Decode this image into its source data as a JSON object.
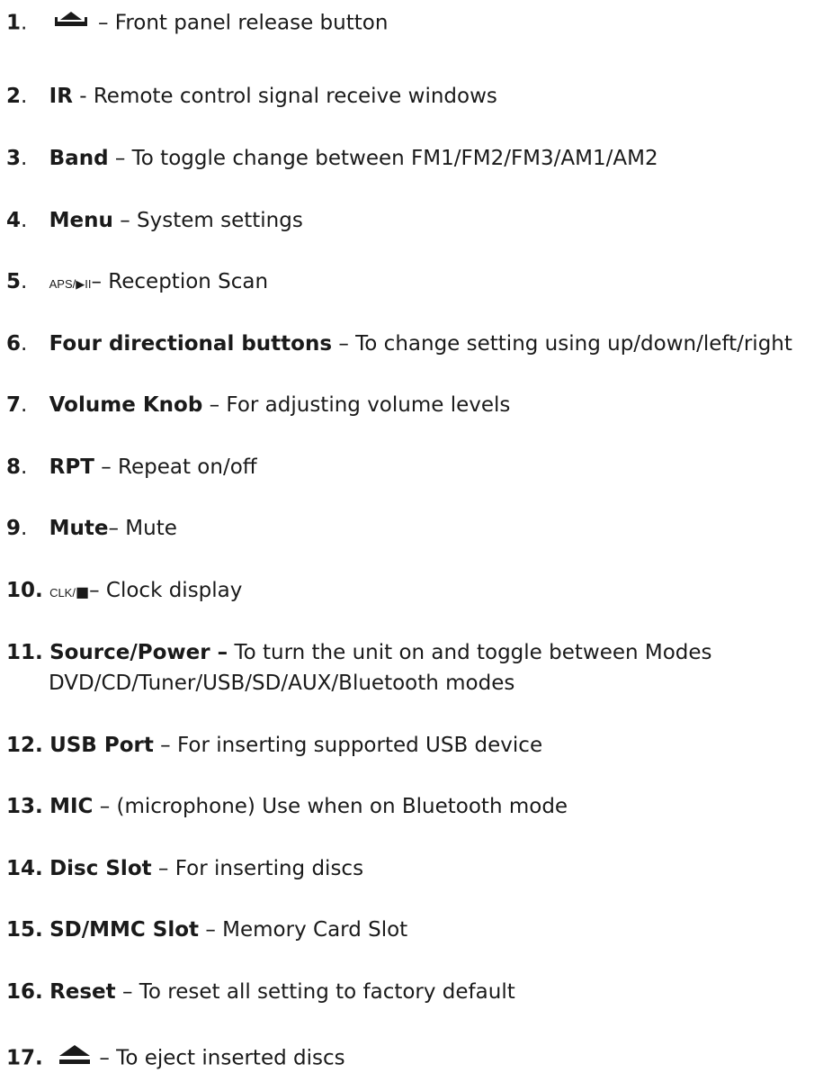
{
  "items": [
    {
      "num": "1",
      "desc": " – Front panel release button",
      "icon": "front-panel-release-icon"
    },
    {
      "num": "2",
      "label": "IR",
      "desc": " - Remote control signal receive windows"
    },
    {
      "num": "3",
      "label": "Band",
      "desc": " – To toggle change between FM1/FM2/FM3/AM1/AM2"
    },
    {
      "num": "4",
      "label": "Menu",
      "desc": " – System settings"
    },
    {
      "num": "5",
      "small": "APS/▶II",
      "desc": "– Reception Scan"
    },
    {
      "num": "6",
      "label": "Four directional buttons",
      "desc": " – To change setting using up/down/left/right"
    },
    {
      "num": "7",
      "label": "Volume Knob",
      "desc": " – For adjusting volume levels"
    },
    {
      "num": "8",
      "label": "RPT",
      "desc": " – Repeat on/off"
    },
    {
      "num": "9",
      "label": "Mute",
      "desc": "– Mute"
    },
    {
      "num": "10.",
      "small": "CLK/",
      "square": "■",
      "desc": "– Clock display"
    },
    {
      "num": "11.",
      "label": "Source/Power –",
      "desc": " To turn the unit on and toggle between Modes",
      "desc2": "DVD/CD/Tuner/USB/SD/AUX/Bluetooth modes"
    },
    {
      "num": "12.",
      "label": "USB Port",
      "desc": " – For inserting supported USB device"
    },
    {
      "num": "13.",
      "label": "MIC",
      "desc": " – (microphone) Use when on Bluetooth mode"
    },
    {
      "num": "14.",
      "label": "Disc Slot",
      "desc": " – For inserting discs"
    },
    {
      "num": "15.",
      "label": "SD/MMC Slot",
      "desc": " – Memory Card Slot"
    },
    {
      "num": "16.",
      "label": "Reset",
      "desc": " – To reset all setting to factory default"
    },
    {
      "num": "17.",
      "desc": " – To eject inserted discs",
      "icon": "eject-icon"
    }
  ],
  "dot_text": "."
}
